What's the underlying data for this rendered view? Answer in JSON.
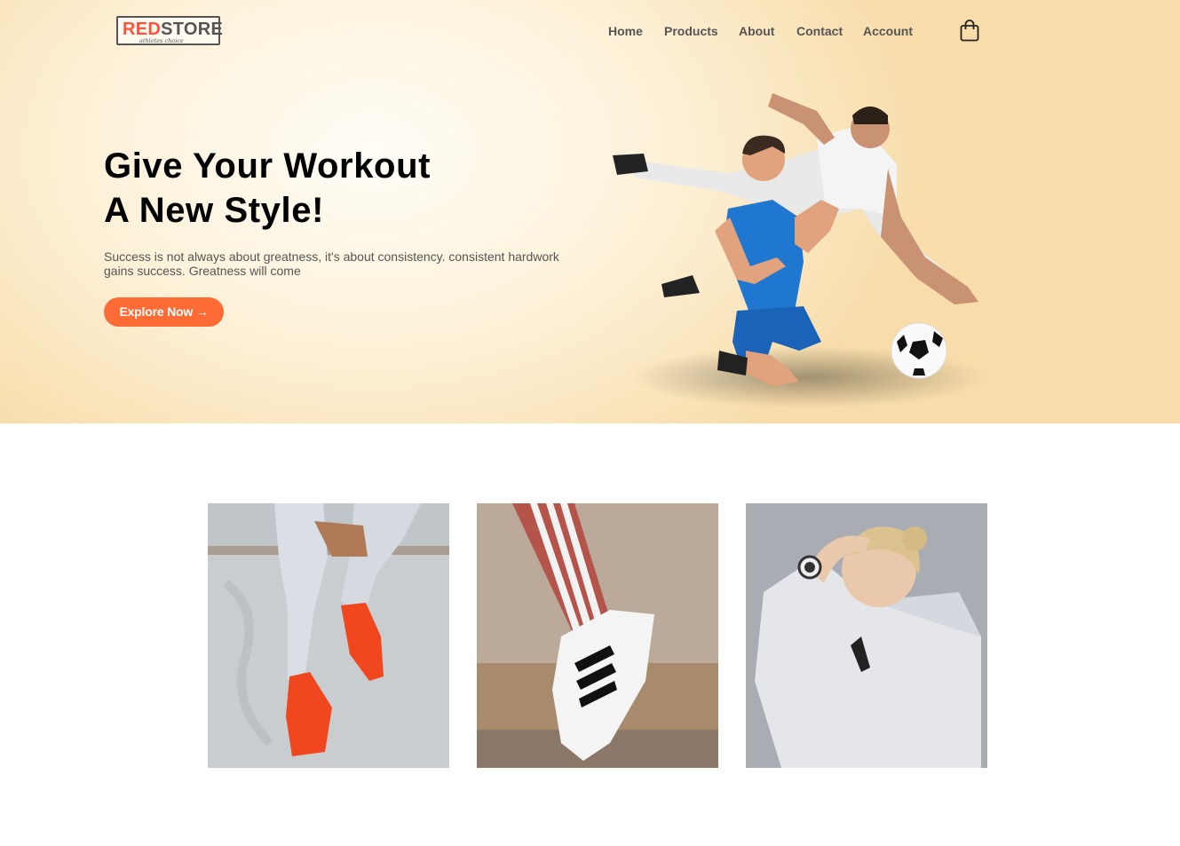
{
  "brand": {
    "name_red": "RED",
    "name_dark": "STORE",
    "tagline": "athletes choice"
  },
  "nav": {
    "items": [
      {
        "label": "Home"
      },
      {
        "label": "Products"
      },
      {
        "label": "About"
      },
      {
        "label": "Contact"
      },
      {
        "label": "Account"
      }
    ],
    "cart_icon": "shopping-bag-icon"
  },
  "hero": {
    "title_line1": "Give Your Workout",
    "title_line2": "A New Style!",
    "description": "Success is not always about greatness, it's about consistency. consistent hardwork gains success. Greatness will come",
    "button_label": "Explore Now →",
    "image": "soccer-players-image"
  },
  "categories": [
    {
      "image": "red-sneakers-image"
    },
    {
      "image": "striped-sneaker-image"
    },
    {
      "image": "white-hoodie-woman-image"
    }
  ],
  "colors": {
    "accent": "#ff523b",
    "button": "#ff6b34",
    "hero_bg": "#f8ddab"
  }
}
